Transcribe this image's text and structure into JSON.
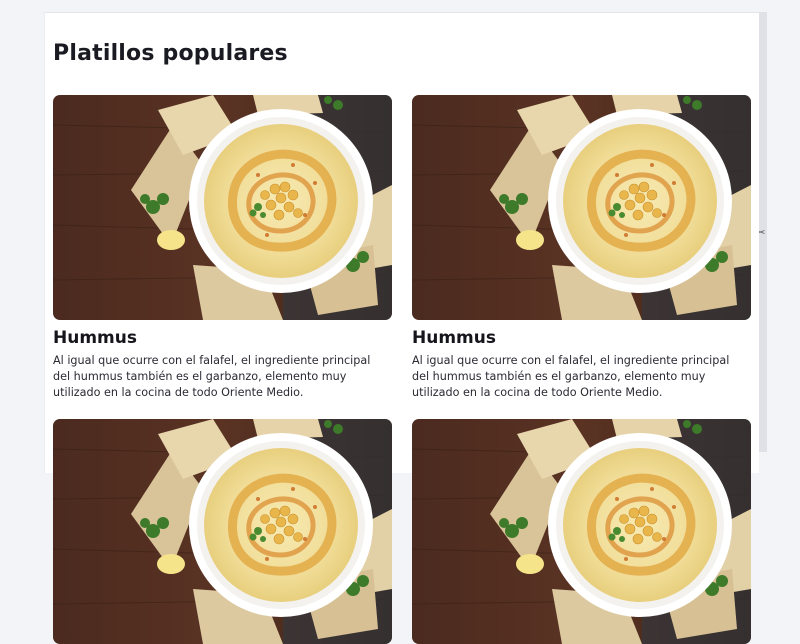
{
  "page": {
    "title": "Platillos populares"
  },
  "cards": [
    {
      "title": "Hummus",
      "description": "Al igual que ocurre con el falafel, el ingrediente principal del hummus también es el garbanzo, elemento muy utilizado en la cocina de todo Oriente Medio.",
      "image": "hummus-photo"
    },
    {
      "title": "Hummus",
      "description": "Al igual que ocurre con el falafel, el ingrediente principal del hummus también es el garbanzo, elemento muy utilizado en la cocina de todo Oriente Medio.",
      "image": "hummus-photo"
    },
    {
      "title": "",
      "description": "",
      "image": "hummus-photo"
    },
    {
      "title": "",
      "description": "",
      "image": "hummus-photo"
    }
  ],
  "colors": {
    "background": "#f3f4f8",
    "card_surface": "#ffffff",
    "wood": "#4a2a1e",
    "hummus": "#f2e3a6",
    "paprika": "#c8641a"
  },
  "icons": {
    "resize": "scissors-icon"
  }
}
